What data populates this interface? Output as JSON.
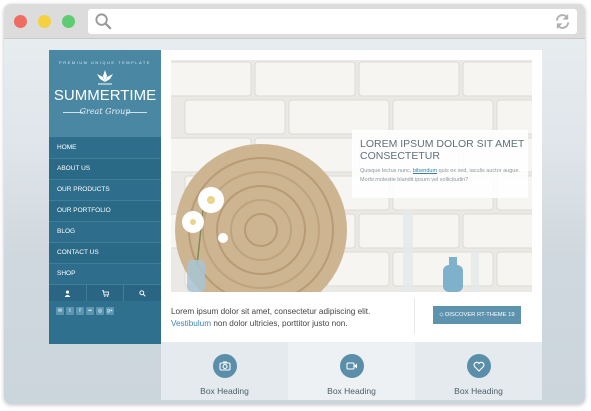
{
  "browser": {
    "controls": [
      "close",
      "minimize",
      "maximize"
    ],
    "search_icon": "search-icon",
    "refresh_icon": "refresh-icon"
  },
  "logo": {
    "arc_text": "PREMIUM UNIQUE TEMPLATE",
    "title": "SUMMERTIME",
    "subtitle": "Great Group"
  },
  "nav": [
    "HOME",
    "ABOUT US",
    "OUR PRODUCTS",
    "OUR PORTFOLIO",
    "BLOG",
    "CONTACT US",
    "SHOP"
  ],
  "tools": [
    "user-icon",
    "cart-icon",
    "search-icon"
  ],
  "socials": [
    "mail-icon",
    "twitter-icon",
    "facebook-icon",
    "flickr-icon",
    "dribbble-icon",
    "google-plus-icon"
  ],
  "slider": {
    "title": "LOREM IPSUM DOLOR SIT AMET CONSECTETUR",
    "text_before": "Quisque lectus nunc,",
    "link": "bibendum",
    "text_after": "quis ex sed, iaculis auctor augue. Morbi molestie blandit ipsum vel sollicitudin?"
  },
  "intro": {
    "line1": "Lorem ipsum dolor sit amet, consectetur adipiscing elit.",
    "link": "Vestibulum",
    "line2_rest": "non dolor ultricies, porttitor justo non."
  },
  "cta": "DISCOVER RT-THEME 19",
  "boxes": [
    {
      "icon": "camera-icon",
      "heading": "Box Heading"
    },
    {
      "icon": "video-icon",
      "heading": "Box Heading"
    },
    {
      "icon": "heart-icon",
      "heading": "Box Heading"
    }
  ],
  "colors": {
    "sidebar": "#2f708f",
    "logo_bg": "#4a87a3",
    "accent": "#5e93ad",
    "link": "#3a86ad"
  }
}
